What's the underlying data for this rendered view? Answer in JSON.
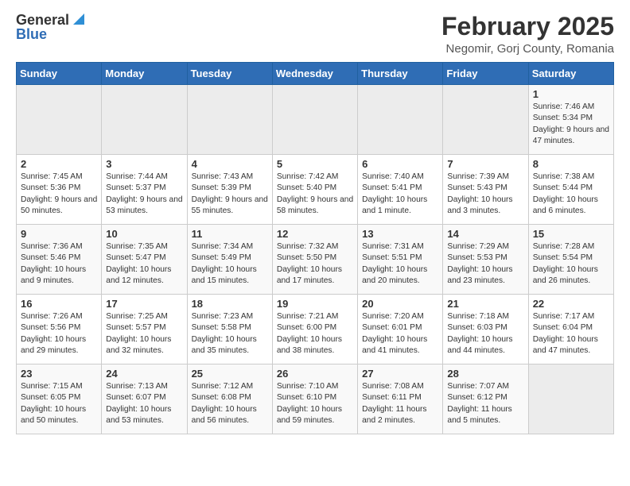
{
  "header": {
    "logo_general": "General",
    "logo_blue": "Blue",
    "title": "February 2025",
    "subtitle": "Negomir, Gorj County, Romania"
  },
  "weekdays": [
    "Sunday",
    "Monday",
    "Tuesday",
    "Wednesday",
    "Thursday",
    "Friday",
    "Saturday"
  ],
  "weeks": [
    [
      {
        "day": "",
        "info": ""
      },
      {
        "day": "",
        "info": ""
      },
      {
        "day": "",
        "info": ""
      },
      {
        "day": "",
        "info": ""
      },
      {
        "day": "",
        "info": ""
      },
      {
        "day": "",
        "info": ""
      },
      {
        "day": "1",
        "info": "Sunrise: 7:46 AM\nSunset: 5:34 PM\nDaylight: 9 hours and 47 minutes."
      }
    ],
    [
      {
        "day": "2",
        "info": "Sunrise: 7:45 AM\nSunset: 5:36 PM\nDaylight: 9 hours and 50 minutes."
      },
      {
        "day": "3",
        "info": "Sunrise: 7:44 AM\nSunset: 5:37 PM\nDaylight: 9 hours and 53 minutes."
      },
      {
        "day": "4",
        "info": "Sunrise: 7:43 AM\nSunset: 5:39 PM\nDaylight: 9 hours and 55 minutes."
      },
      {
        "day": "5",
        "info": "Sunrise: 7:42 AM\nSunset: 5:40 PM\nDaylight: 9 hours and 58 minutes."
      },
      {
        "day": "6",
        "info": "Sunrise: 7:40 AM\nSunset: 5:41 PM\nDaylight: 10 hours and 1 minute."
      },
      {
        "day": "7",
        "info": "Sunrise: 7:39 AM\nSunset: 5:43 PM\nDaylight: 10 hours and 3 minutes."
      },
      {
        "day": "8",
        "info": "Sunrise: 7:38 AM\nSunset: 5:44 PM\nDaylight: 10 hours and 6 minutes."
      }
    ],
    [
      {
        "day": "9",
        "info": "Sunrise: 7:36 AM\nSunset: 5:46 PM\nDaylight: 10 hours and 9 minutes."
      },
      {
        "day": "10",
        "info": "Sunrise: 7:35 AM\nSunset: 5:47 PM\nDaylight: 10 hours and 12 minutes."
      },
      {
        "day": "11",
        "info": "Sunrise: 7:34 AM\nSunset: 5:49 PM\nDaylight: 10 hours and 15 minutes."
      },
      {
        "day": "12",
        "info": "Sunrise: 7:32 AM\nSunset: 5:50 PM\nDaylight: 10 hours and 17 minutes."
      },
      {
        "day": "13",
        "info": "Sunrise: 7:31 AM\nSunset: 5:51 PM\nDaylight: 10 hours and 20 minutes."
      },
      {
        "day": "14",
        "info": "Sunrise: 7:29 AM\nSunset: 5:53 PM\nDaylight: 10 hours and 23 minutes."
      },
      {
        "day": "15",
        "info": "Sunrise: 7:28 AM\nSunset: 5:54 PM\nDaylight: 10 hours and 26 minutes."
      }
    ],
    [
      {
        "day": "16",
        "info": "Sunrise: 7:26 AM\nSunset: 5:56 PM\nDaylight: 10 hours and 29 minutes."
      },
      {
        "day": "17",
        "info": "Sunrise: 7:25 AM\nSunset: 5:57 PM\nDaylight: 10 hours and 32 minutes."
      },
      {
        "day": "18",
        "info": "Sunrise: 7:23 AM\nSunset: 5:58 PM\nDaylight: 10 hours and 35 minutes."
      },
      {
        "day": "19",
        "info": "Sunrise: 7:21 AM\nSunset: 6:00 PM\nDaylight: 10 hours and 38 minutes."
      },
      {
        "day": "20",
        "info": "Sunrise: 7:20 AM\nSunset: 6:01 PM\nDaylight: 10 hours and 41 minutes."
      },
      {
        "day": "21",
        "info": "Sunrise: 7:18 AM\nSunset: 6:03 PM\nDaylight: 10 hours and 44 minutes."
      },
      {
        "day": "22",
        "info": "Sunrise: 7:17 AM\nSunset: 6:04 PM\nDaylight: 10 hours and 47 minutes."
      }
    ],
    [
      {
        "day": "23",
        "info": "Sunrise: 7:15 AM\nSunset: 6:05 PM\nDaylight: 10 hours and 50 minutes."
      },
      {
        "day": "24",
        "info": "Sunrise: 7:13 AM\nSunset: 6:07 PM\nDaylight: 10 hours and 53 minutes."
      },
      {
        "day": "25",
        "info": "Sunrise: 7:12 AM\nSunset: 6:08 PM\nDaylight: 10 hours and 56 minutes."
      },
      {
        "day": "26",
        "info": "Sunrise: 7:10 AM\nSunset: 6:10 PM\nDaylight: 10 hours and 59 minutes."
      },
      {
        "day": "27",
        "info": "Sunrise: 7:08 AM\nSunset: 6:11 PM\nDaylight: 11 hours and 2 minutes."
      },
      {
        "day": "28",
        "info": "Sunrise: 7:07 AM\nSunset: 6:12 PM\nDaylight: 11 hours and 5 minutes."
      },
      {
        "day": "",
        "info": ""
      }
    ]
  ]
}
